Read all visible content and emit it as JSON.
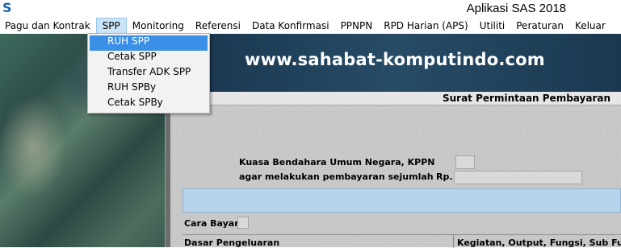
{
  "app": {
    "logo_letter": "S",
    "title": "Aplikasi SAS 2018"
  },
  "menubar": {
    "items": [
      {
        "label": "Pagu dan Kontrak"
      },
      {
        "label": "SPP"
      },
      {
        "label": "Monitoring"
      },
      {
        "label": "Referensi"
      },
      {
        "label": "Data Konfirmasi"
      },
      {
        "label": "PPNPN"
      },
      {
        "label": "RPD Harian (APS)"
      },
      {
        "label": "Utiliti"
      },
      {
        "label": "Peraturan"
      },
      {
        "label": "Keluar"
      }
    ],
    "active": "SPP"
  },
  "dropdown": {
    "items": [
      {
        "label": "RUH SPP"
      },
      {
        "label": "Cetak SPP"
      },
      {
        "label": "Transfer ADK SPP"
      },
      {
        "label": "RUH SPBy"
      },
      {
        "label": "Cetak SPBy"
      }
    ],
    "selected": "RUH SPP"
  },
  "banner": {
    "text": "www.sahabat-komputindo.com"
  },
  "form": {
    "title": "Surat Permintaan Pembayaran",
    "kuasa_label": "Kuasa Bendahara Umum Negara, KPPN",
    "kppn_value": "",
    "agar_label": "agar melakukan pembayaran sejumlah",
    "rp_label": "Rp.",
    "amount_value": "",
    "cara_bayar_label": "Cara Bayar",
    "cara_bayar_value": "",
    "dasar_label": "Dasar Pengeluaran",
    "kegiatan_label": "Kegiatan, Output, Fungsi, Sub Fungsi"
  },
  "colors": {
    "selected": "#3a8fe6",
    "menu_active": "#cce4f7",
    "banner": "#1b3f5a"
  }
}
